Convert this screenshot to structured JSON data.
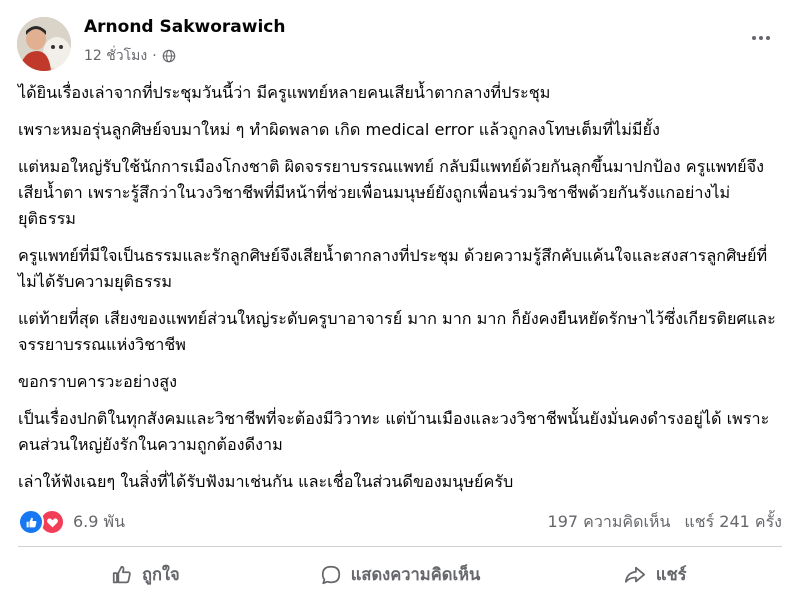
{
  "post": {
    "author": "Arnond Sakworawich",
    "time": "12 ชั่วโมง",
    "separator": "·",
    "paragraphs": [
      "ได้ยินเรื่องเล่าจากที่ประชุมวันนี้ว่า มีครูแพทย์หลายคนเสียน้ำตากลางที่ประชุม",
      "เพราะหมอรุ่นลูกศิษย์จบมาใหม่ ๆ ทำผิดพลาด เกิด medical error แล้วถูกลงโทษเต็มที่ไม่มียั้ง",
      "แต่หมอใหญ่รับใช้นักการเมืองโกงชาติ ผิดจรรยาบรรณแพทย์ กลับมีแพทย์ด้วยกันลุกขึ้นมาปกป้อง ครูแพทย์จึงเสียน้ำตา เพราะรู้สึกว่าในวงวิชาชีพที่มีหน้าที่ช่วยเพื่อนมนุษย์ยังถูกเพื่อนร่วมวิชาชีพด้วยกันรังแกอย่างไม่ยุติธรรม",
      "ครูแพทย์ที่มีใจเป็นธรรมและรักลูกศิษย์จึงเสียน้ำตากลางที่ประชุม ด้วยความรู้สึกคับแค้นใจและสงสารลูกศิษย์ที่ไม่ได้รับความยุติธรรม",
      "แต่ท้ายที่สุด เสียงของแพทย์ส่วนใหญ่ระดับครูบาอาจารย์ มาก มาก มาก ก็ยังคงยืนหยัดรักษาไว้ซึ่งเกียรติยศและจรรยาบรรณแห่งวิชาชีพ",
      "ขอกราบคารวะอย่างสูง",
      "เป็นเรื่องปกติในทุกสังคมและวิชาชีพที่จะต้องมีวิวาทะ แต่บ้านเมืองและวงวิชาชีพนั้นยังมั่นคงดำรงอยู่ได้ เพราะคนส่วนใหญ่ยังรักในความถูกต้องดีงาม",
      "เล่าให้ฟังเฉยๆ ในสิ่งที่ได้รับฟังมาเช่นกัน และเชื่อในส่วนดีของมนุษย์ครับ"
    ]
  },
  "stats": {
    "reactions": "6.9 พัน",
    "comments": "197 ความคิดเห็น",
    "shares": "แชร์ 241 ครั้ง"
  },
  "actions": {
    "like": "ถูกใจ",
    "comment": "แสดงความคิดเห็น",
    "share": "แชร์"
  },
  "icons": {
    "globe": "globe-icon",
    "more": "more-options-icon",
    "like_reaction": "thumbs-up-icon",
    "love_reaction": "heart-icon",
    "like_action": "thumbs-up-outline-icon",
    "comment_action": "speech-bubble-icon",
    "share_action": "share-arrow-icon"
  },
  "colors": {
    "like_blue": "#1877f2",
    "love_red": "#f33e58",
    "secondary_text": "#65676b",
    "primary_text": "#050505"
  }
}
